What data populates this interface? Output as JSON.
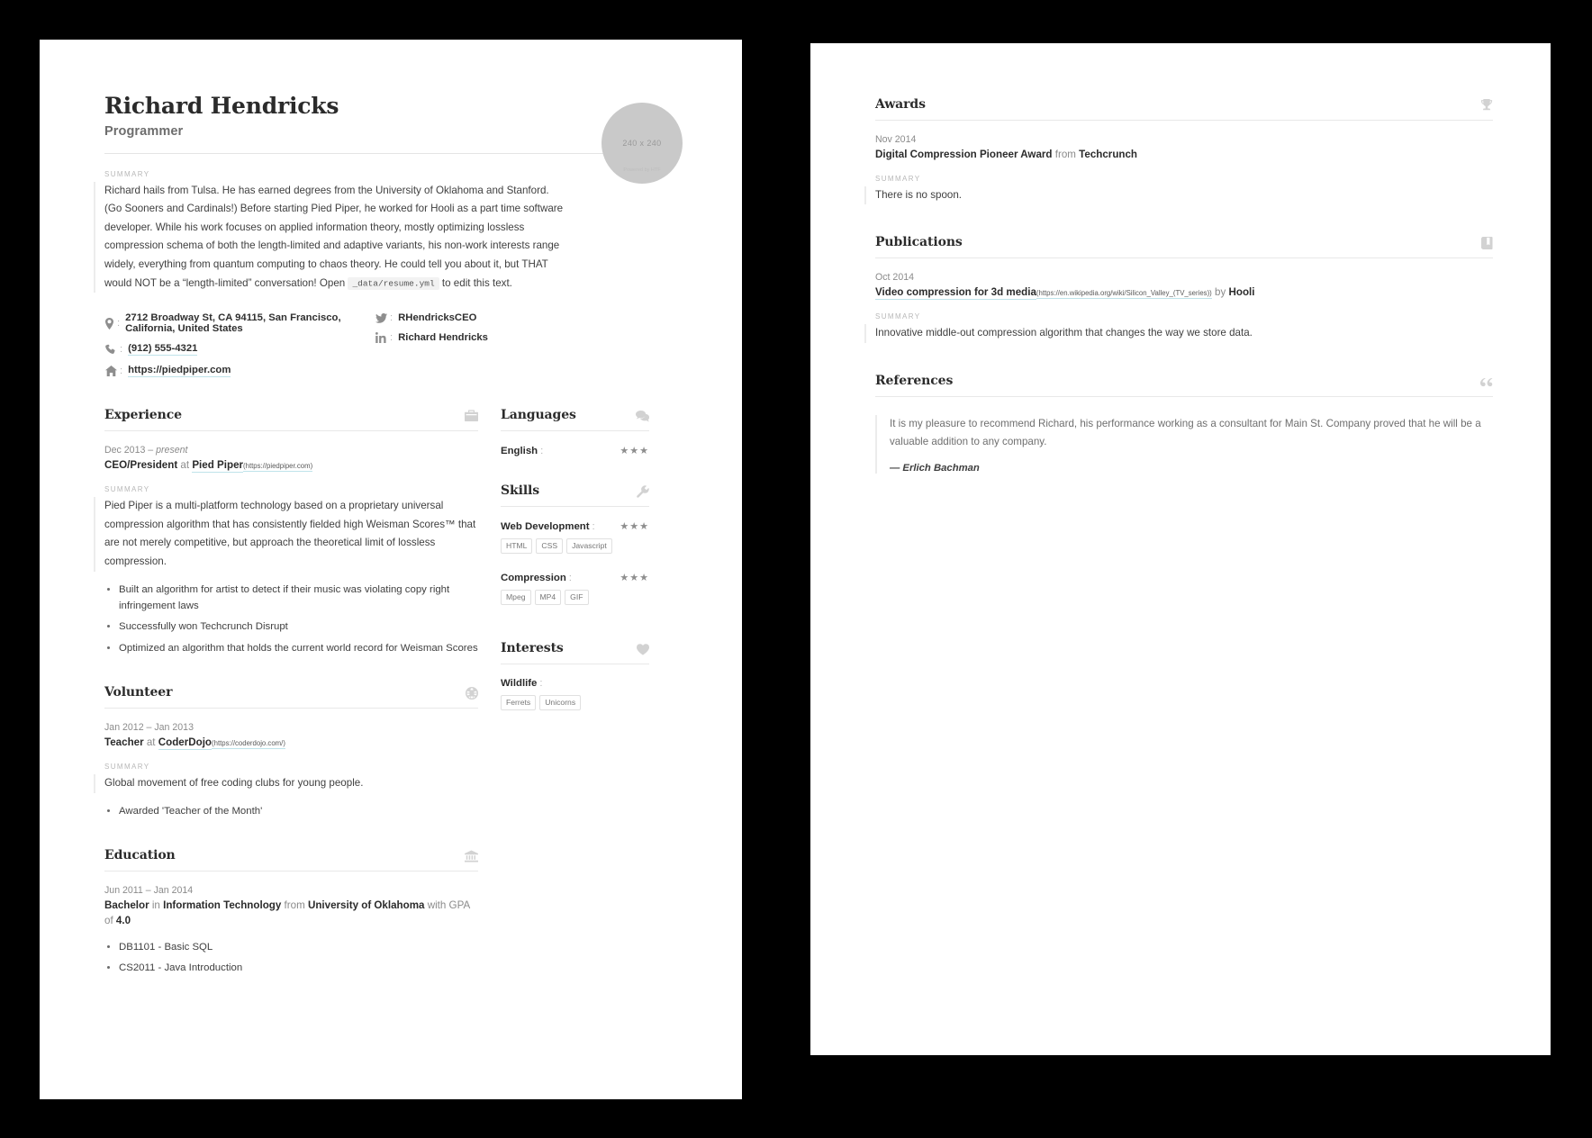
{
  "header": {
    "name": "Richard Hendricks",
    "label": "Programmer",
    "photo": {
      "dimensions": "240 x 240",
      "credit": "Powered by HTF"
    },
    "summary_kicker": "SUMMARY",
    "summary_part1": "Richard hails from Tulsa. He has earned degrees from the University of Oklahoma and Stanford. (Go Sooners and Cardinals!) Before starting Pied Piper, he worked for Hooli as a part time software developer. While his work focuses on applied information theory, mostly optimizing lossless compression schema of both the length-limited and adaptive variants, his non-work interests range widely, everything from quantum computing to chaos theory. He could tell you about it, but THAT would NOT be a “length-limited” conversation! Open",
    "summary_code": "_data/resume.yml",
    "summary_part2": "to edit this text."
  },
  "contact": {
    "address": "2712 Broadway St, CA 94115, San Francisco, California, United States",
    "phone": "(912) 555-4321",
    "website": "https://piedpiper.com",
    "twitter": "RHendricksCEO",
    "linkedin": "Richard Hendricks",
    "separator": ":"
  },
  "experience": {
    "title": "Experience",
    "icon": "briefcase-icon",
    "entries": [
      {
        "date": "Dec 2013 – ",
        "date_em": "present",
        "position": "CEO/President",
        "connector": "at",
        "company": "Pied Piper",
        "url": "(https://piedpiper.com)",
        "summary_kicker": "SUMMARY",
        "summary": "Pied Piper is a multi-platform technology based on a proprietary universal compression algorithm that has consistently fielded high Weisman Scores™ that are not merely competitive, but approach the theoretical limit of lossless compression.",
        "highlights": [
          "Built an algorithm for artist to detect if their music was violating copy right infringement laws",
          "Successfully won Techcrunch Disrupt",
          "Optimized an algorithm that holds the current world record for Weisman Scores"
        ]
      }
    ]
  },
  "volunteer": {
    "title": "Volunteer",
    "icon": "globe-icon",
    "entries": [
      {
        "date": "Jan 2012 – Jan 2013",
        "position": "Teacher",
        "connector": "at",
        "organization": "CoderDojo",
        "url": "(https://coderdojo.com/)",
        "summary_kicker": "SUMMARY",
        "summary": "Global movement of free coding clubs for young people.",
        "highlights": [
          "Awarded 'Teacher of the Month'"
        ]
      }
    ]
  },
  "education": {
    "title": "Education",
    "icon": "university-icon",
    "entries": [
      {
        "date": "Jun 2011 – Jan 2014",
        "study_type": "Bachelor",
        "connector_in": "in",
        "area": "Information Technology",
        "connector_from": "from",
        "institution": "University of Oklahoma",
        "connector_gpa": "with GPA of",
        "gpa": "4.0",
        "courses": [
          "DB1101 - Basic SQL",
          "CS2011 - Java Introduction"
        ]
      }
    ]
  },
  "languages": {
    "title": "Languages",
    "icon": "speech-bubbles-icon",
    "items": [
      {
        "name": "English",
        "separator": ":",
        "stars": "★★★",
        "level": 3
      }
    ]
  },
  "skills": {
    "title": "Skills",
    "icon": "wrench-icon",
    "items": [
      {
        "name": "Web Development",
        "separator": ":",
        "stars": "★★★",
        "level": 3,
        "keywords": [
          "HTML",
          "CSS",
          "Javascript"
        ]
      },
      {
        "name": "Compression",
        "separator": ":",
        "stars": "★★★",
        "level": 3,
        "keywords": [
          "Mpeg",
          "MP4",
          "GIF"
        ]
      }
    ]
  },
  "interests": {
    "title": "Interests",
    "icon": "heart-icon",
    "items": [
      {
        "name": "Wildlife",
        "separator": ":",
        "keywords": [
          "Ferrets",
          "Unicorns"
        ]
      }
    ]
  },
  "awards": {
    "title": "Awards",
    "icon": "trophy-icon",
    "entries": [
      {
        "date": "Nov 2014",
        "title": "Digital Compression Pioneer Award",
        "connector": "from",
        "awarder": "Techcrunch",
        "summary_kicker": "SUMMARY",
        "summary": "There is no spoon."
      }
    ]
  },
  "publications": {
    "title": "Publications",
    "icon": "book-icon",
    "entries": [
      {
        "date": "Oct 2014",
        "name": "Video compression for 3d media",
        "url": "(https://en.wikipedia.org/wiki/Silicon_Valley_(TV_series))",
        "connector": "by",
        "publisher": "Hooli",
        "summary_kicker": "SUMMARY",
        "summary": "Innovative middle-out compression algorithm that changes the way we store data."
      }
    ]
  },
  "references": {
    "title": "References",
    "icon": "quote-icon",
    "entries": [
      {
        "reference": "It is my pleasure to recommend Richard, his performance working as a consultant for Main St. Company proved that he will be a valuable addition to any company.",
        "name": "— Erlich Bachman"
      }
    ]
  }
}
